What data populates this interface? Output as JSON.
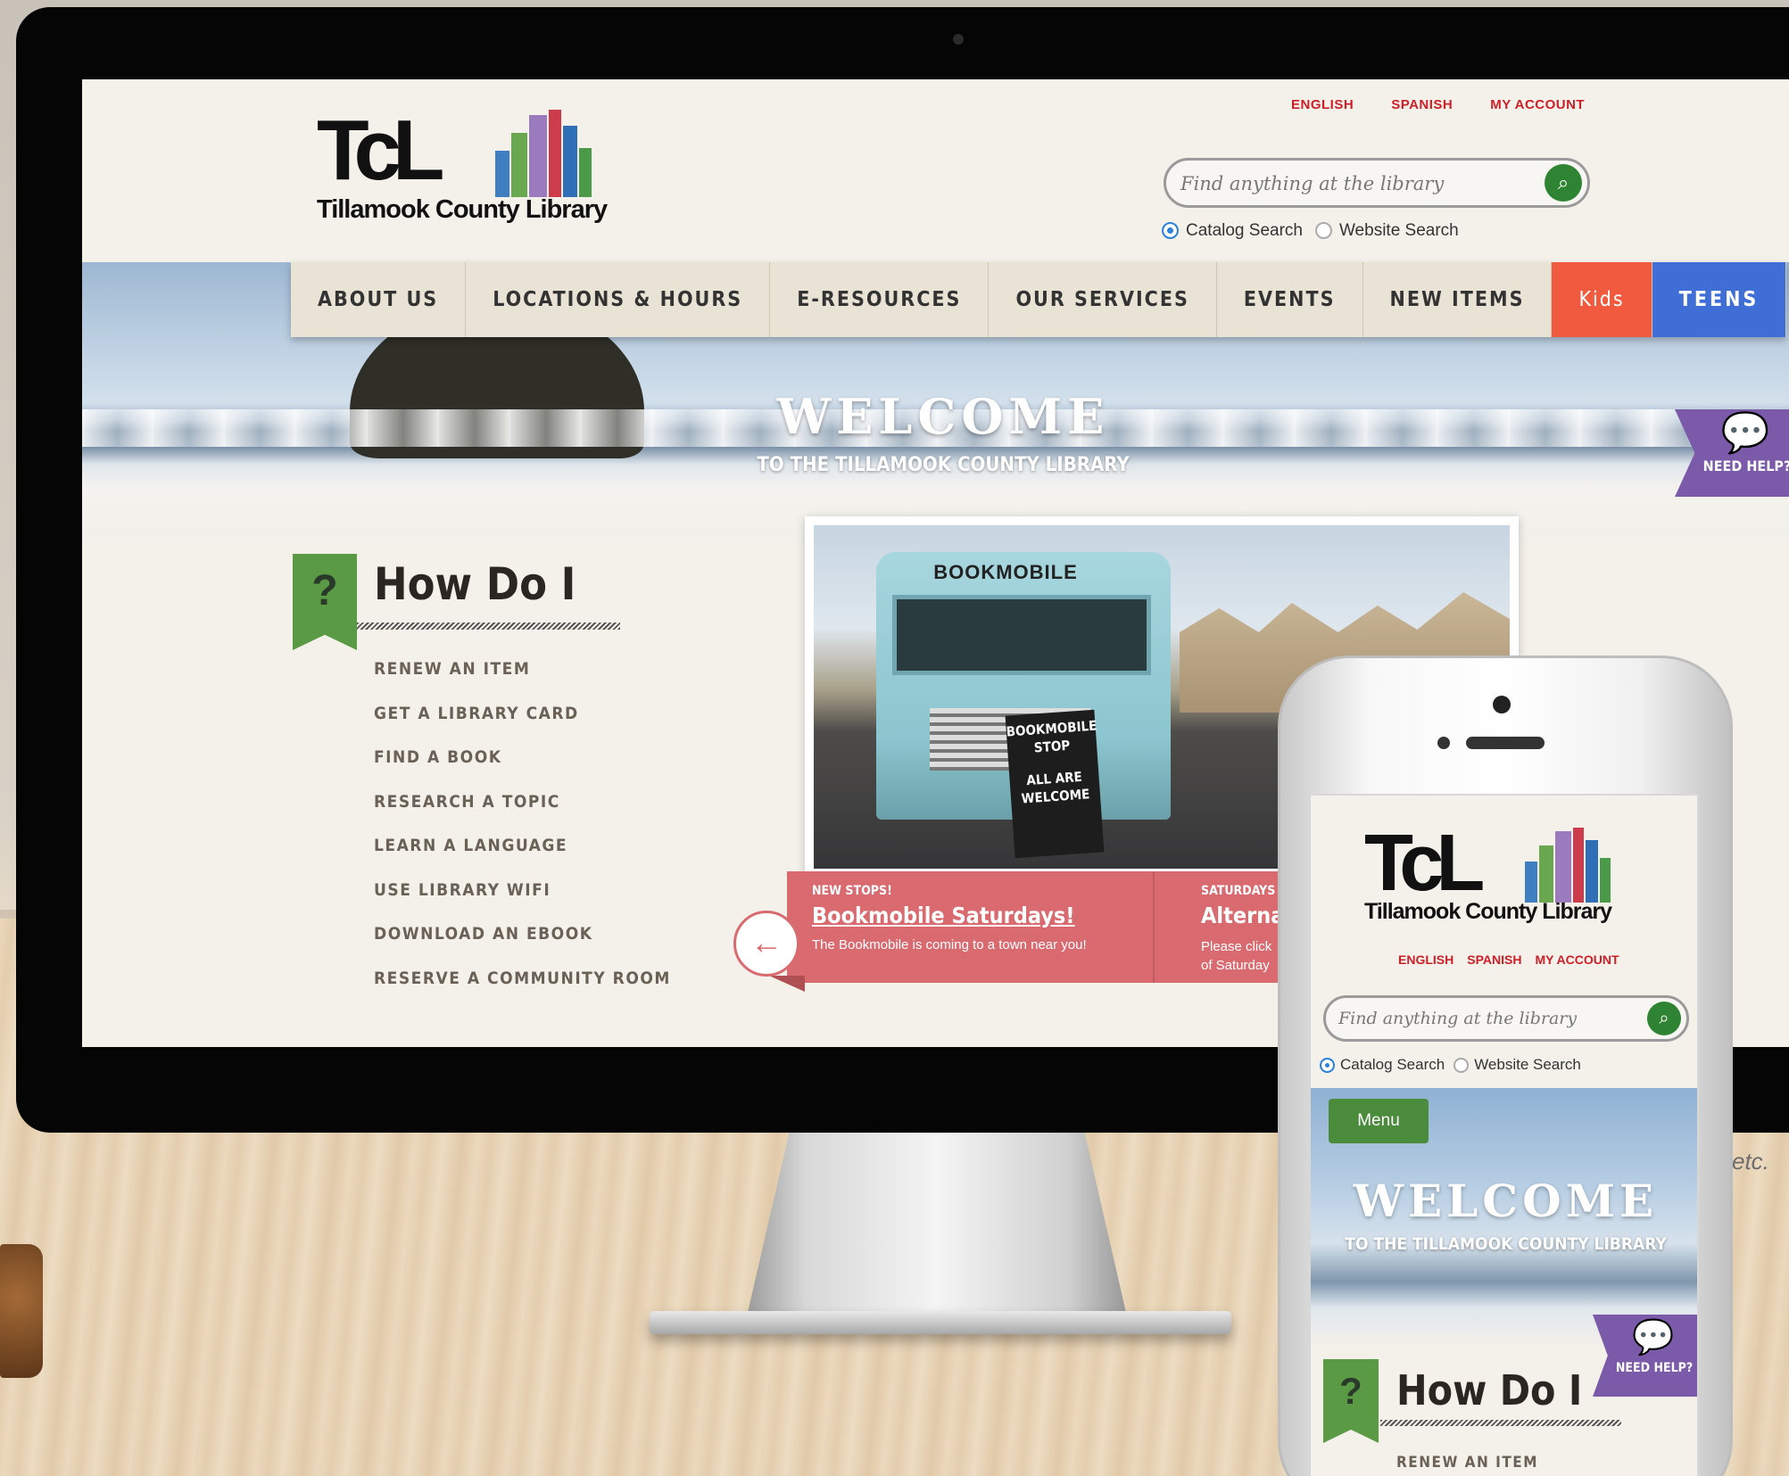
{
  "desktop": {
    "logo": {
      "mark": "TcL",
      "name": "Tillamook County Library",
      "bar_colors": [
        "#3f7ec1",
        "#6aa84f",
        "#9b7bbd",
        "#cc3c4b",
        "#2f6fb8",
        "#4a9a4a"
      ]
    },
    "top_links": [
      "ENGLISH",
      "SPANISH",
      "MY ACCOUNT"
    ],
    "search": {
      "placeholder": "Find anything at the library",
      "options": [
        "Catalog Search",
        "Website Search"
      ],
      "selected": "Catalog Search"
    },
    "nav": {
      "items": [
        "ABOUT US",
        "LOCATIONS & HOURS",
        "E-RESOURCES",
        "OUR SERVICES",
        "EVENTS",
        "NEW ITEMS"
      ],
      "kids": "Kids",
      "teens": "TEENS"
    },
    "hero": {
      "title": "WELCOME",
      "subtitle": "TO THE TILLAMOOK COUNTY LIBRARY"
    },
    "need_help": "NEED HELP?",
    "how_do_i": {
      "badge": "?",
      "title": "How Do I",
      "items": [
        "RENEW AN ITEM",
        "GET A LIBRARY CARD",
        "FIND A BOOK",
        "RESEARCH A TOPIC",
        "LEARN A LANGUAGE",
        "USE LIBRARY WIFI",
        "DOWNLOAD AN EBOOK",
        "RESERVE A COMMUNITY ROOM"
      ]
    },
    "slider": {
      "photo_text": {
        "bus": "BOOKMOBILE",
        "sign_top": "BOOKMOBILE STOP",
        "sign_bottom": "ALL ARE WELCOME"
      },
      "slides": [
        {
          "kicker": "NEW STOPS!",
          "title": "Bookmobile Saturdays!",
          "text": "The Bookmobile is coming to a town near you!"
        },
        {
          "kicker": "SATURDAYS",
          "title": "Alternatin",
          "text": "Please click",
          "text2": "of Saturday"
        }
      ],
      "prev_arrow": "←"
    }
  },
  "side_note": "etc.",
  "phone": {
    "logo": {
      "mark": "TcL",
      "name": "Tillamook County Library"
    },
    "top_links": [
      "ENGLISH",
      "SPANISH",
      "MY ACCOUNT"
    ],
    "search": {
      "placeholder": "Find anything at the library",
      "options": [
        "Catalog Search",
        "Website Search"
      ]
    },
    "menu": "Menu",
    "hero": {
      "title": "WELCOME",
      "subtitle": "TO THE TILLAMOOK COUNTY LIBRARY"
    },
    "need_help": "NEED HELP?",
    "how_do_i": {
      "badge": "?",
      "title": "How Do I",
      "first_item": "RENEW AN ITEM"
    }
  }
}
